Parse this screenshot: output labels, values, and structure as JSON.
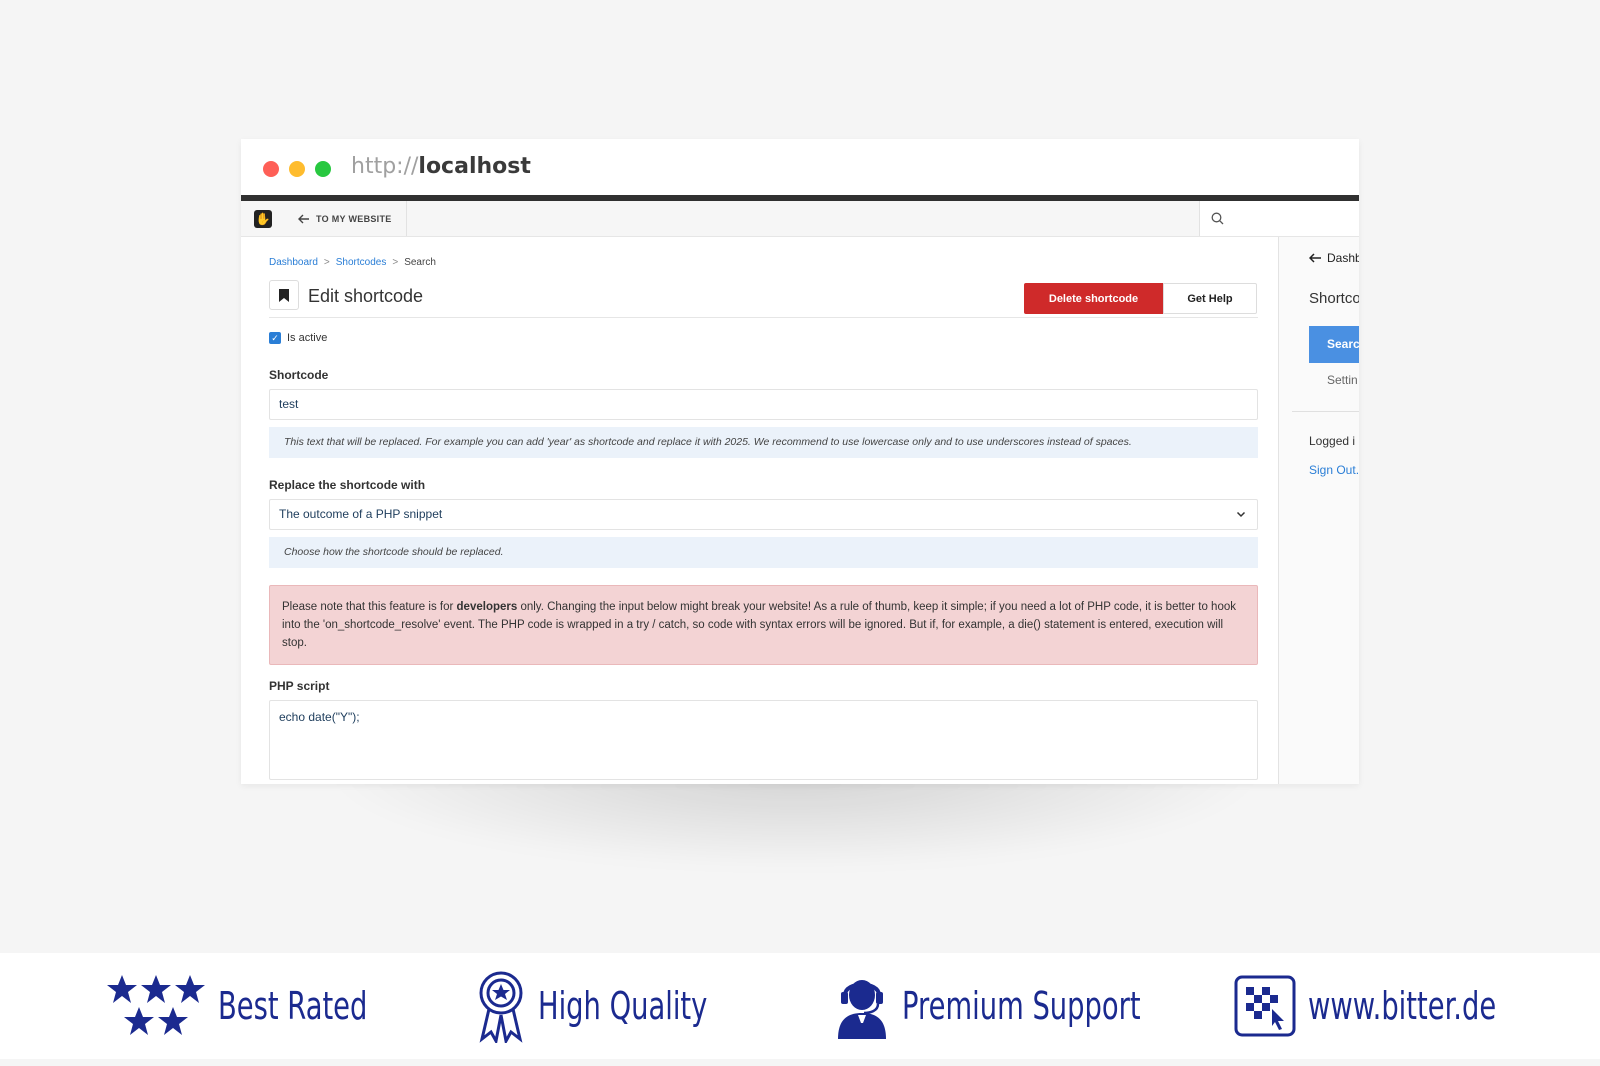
{
  "browser": {
    "url_protocol": "http://",
    "url_host": "localhost"
  },
  "toolbar": {
    "back_label": "TO MY WEBSITE"
  },
  "breadcrumb": [
    {
      "label": "Dashboard",
      "link": true
    },
    {
      "label": "Shortcodes",
      "link": true
    },
    {
      "label": "Search",
      "link": false
    }
  ],
  "breadcrumb_separator": ">",
  "page": {
    "title": "Edit shortcode",
    "delete_label": "Delete shortcode",
    "help_label": "Get Help"
  },
  "form": {
    "is_active_label": "Is active",
    "is_active": true,
    "shortcode_label": "Shortcode",
    "shortcode_value": "test",
    "shortcode_help": "This text that will be replaced. For example you can add 'year' as shortcode and replace it with 2025. We recommend to use lowercase only and to use underscores instead of spaces.",
    "replace_label": "Replace the shortcode with",
    "replace_value": "The outcome of a PHP snippet",
    "replace_help": "Choose how the shortcode should be replaced.",
    "alert_before": "Please note that this feature is for ",
    "alert_bold": "developers",
    "alert_after": " only. Changing the input below might break your website! As a rule of thumb, keep it simple; if you need a lot of PHP code, it is better to hook into the 'on_shortcode_resolve' event. The PHP code is wrapped in a try / catch, so code with syntax errors will be ignored. But if, for example, a die() statement is entered, execution will stop.",
    "php_label": "PHP script",
    "php_value": "echo date(\"Y\");"
  },
  "panel": {
    "back_label": "Dashb",
    "title": "Shortco",
    "search_button": "Searc",
    "settings": "Settin",
    "logged_in": "Logged i",
    "sign_out": "Sign Out."
  },
  "badges": [
    {
      "label": "Best Rated",
      "icon": "stars-icon"
    },
    {
      "label": "High Quality",
      "icon": "award-ribbon-icon"
    },
    {
      "label": "Premium Support",
      "icon": "support-agent-icon"
    },
    {
      "label": "www.bitter.de",
      "icon": "bitter-logo-icon"
    }
  ],
  "colors": {
    "danger": "#cf2a2a",
    "primary": "#2a7ed6",
    "badge_blue": "#1b2a8f",
    "alert_bg": "#f3d3d4",
    "help_bg": "#ebf2fa"
  }
}
